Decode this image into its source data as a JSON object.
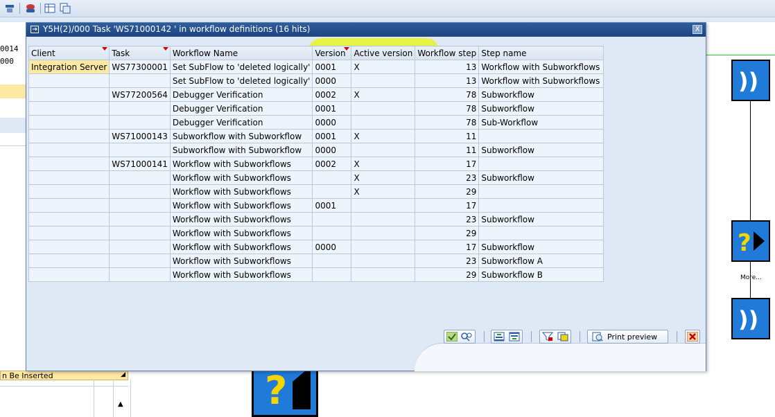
{
  "dialog": {
    "title": "Y5H(2)/000 Task 'WS71000142 ' in workflow definitions (16 hits)",
    "close_label": "X"
  },
  "table": {
    "headers": [
      "Client",
      "Task",
      "Workflow Name",
      "Version",
      "Active version",
      "Workflow step",
      "Step name"
    ],
    "rows": [
      [
        "Integration Server",
        "WS77300001",
        "Set SubFlow to 'deleted logically'",
        "0001",
        "X",
        "13",
        "Workflow with Subworkflows"
      ],
      [
        "",
        "",
        "Set SubFlow to 'deleted logically'",
        "0000",
        "",
        "13",
        "Workflow with Subworkflows"
      ],
      [
        "",
        "WS77200564",
        "Debugger Verification",
        "0002",
        "X",
        "78",
        "Subworkflow"
      ],
      [
        "",
        "",
        "Debugger Verification",
        "0001",
        "",
        "78",
        "Subworkflow"
      ],
      [
        "",
        "",
        "Debugger Verification",
        "0000",
        "",
        "78",
        "Sub-Workflow"
      ],
      [
        "",
        "WS71000143",
        "Subworkflow with Subworkflow",
        "0001",
        "X",
        "11",
        ""
      ],
      [
        "",
        "",
        "Subworkflow with Subworkflow",
        "0000",
        "",
        "11",
        "Subworkflow"
      ],
      [
        "",
        "WS71000141",
        "Workflow with Subworkflows",
        "0002",
        "X",
        "17",
        ""
      ],
      [
        "",
        "",
        "Workflow with Subworkflows",
        "",
        "X",
        "23",
        "Subworkflow"
      ],
      [
        "",
        "",
        "Workflow with Subworkflows",
        "",
        "X",
        "29",
        ""
      ],
      [
        "",
        "",
        "Workflow with Subworkflows",
        "0001",
        "",
        "17",
        ""
      ],
      [
        "",
        "",
        "Workflow with Subworkflows",
        "",
        "",
        "23",
        "Subworkflow"
      ],
      [
        "",
        "",
        "Workflow with Subworkflows",
        "",
        "",
        "29",
        ""
      ],
      [
        "",
        "",
        "Workflow with Subworkflows",
        "0000",
        "",
        "17",
        "Subworkflow"
      ],
      [
        "",
        "",
        "Workflow with Subworkflows",
        "",
        "",
        "23",
        "Subworkflow A"
      ],
      [
        "",
        "",
        "Workflow with Subworkflows",
        "",
        "",
        "29",
        "Subworkflow B"
      ]
    ]
  },
  "footer": {
    "print_preview_label": "Print preview"
  },
  "background": {
    "left_cells": [
      "0014",
      "000"
    ],
    "inserted_field": "n Be Inserted",
    "more_label": "More..."
  },
  "colors": {
    "title_bar": "#1c4480",
    "highlight": "#e9f500",
    "client_cell": "#fde8a4",
    "node_blue": "#1f7ad8",
    "connector_green": "#27c927"
  }
}
